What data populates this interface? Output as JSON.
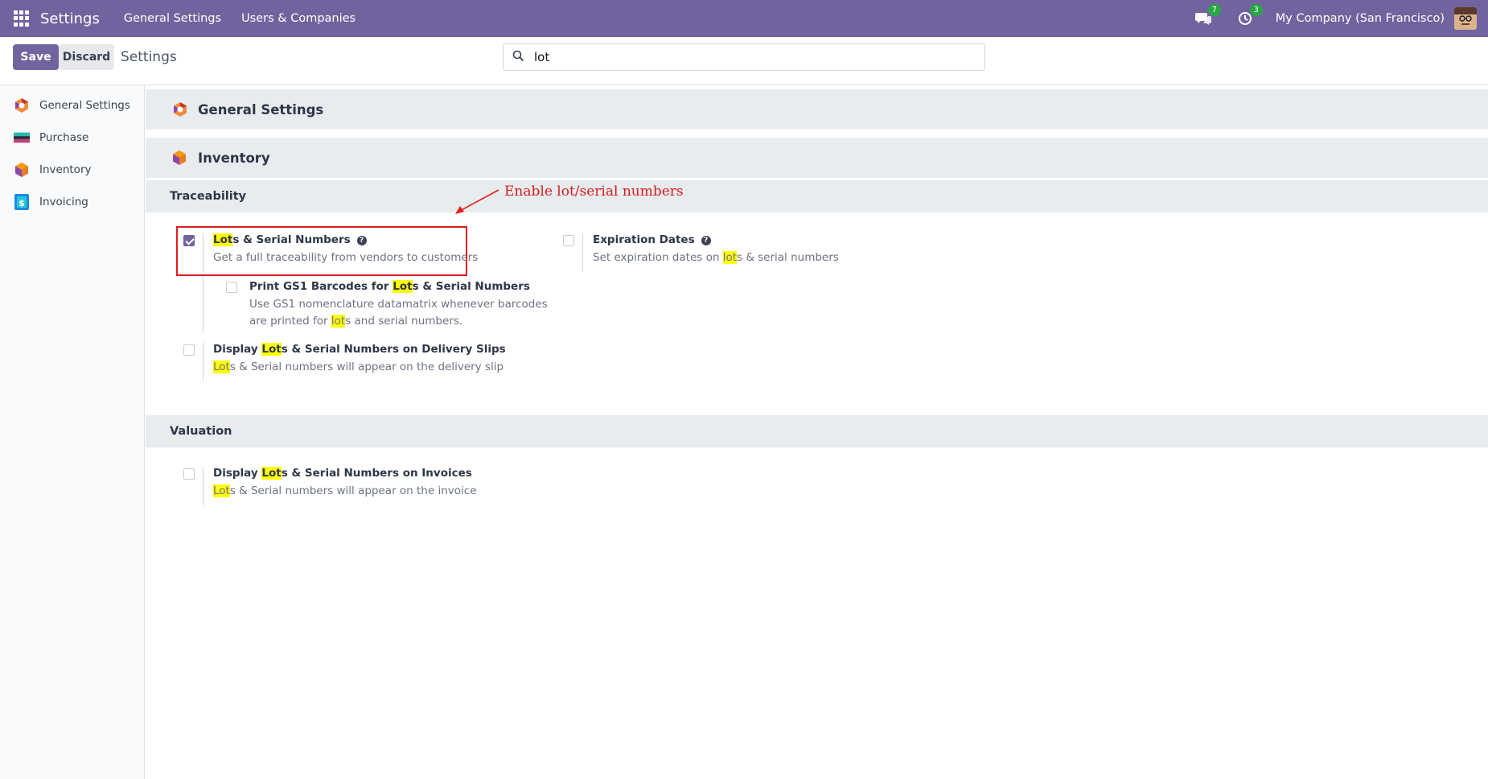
{
  "topbar": {
    "brand": "Settings",
    "menu": [
      "General Settings",
      "Users & Companies"
    ],
    "messages_badge": "7",
    "activities_badge": "3",
    "company": "My Company (San Francisco)",
    "color": "#71639e"
  },
  "control": {
    "save_label": "Save",
    "discard_label": "Discard",
    "title": "Settings",
    "search_value": "lot"
  },
  "sidebar": {
    "items": [
      {
        "label": "General Settings",
        "icon": "general-settings-icon"
      },
      {
        "label": "Purchase",
        "icon": "purchase-icon"
      },
      {
        "label": "Inventory",
        "icon": "inventory-icon"
      },
      {
        "label": "Invoicing",
        "icon": "invoicing-icon"
      }
    ]
  },
  "main": {
    "apps": [
      {
        "title": "General Settings"
      },
      {
        "title": "Inventory"
      }
    ],
    "sections": [
      {
        "title": "Traceability"
      },
      {
        "title": "Valuation"
      }
    ],
    "settings": {
      "lots": {
        "checked": true,
        "title_hl": "Lot",
        "title_rest": "s & Serial Numbers",
        "desc": "Get a full traceability from vendors to customers"
      },
      "expiration": {
        "checked": false,
        "title": "Expiration Dates",
        "desc_pre": "Set expiration dates on ",
        "desc_hl": "lot",
        "desc_post": "s & serial numbers"
      },
      "gs1": {
        "checked": false,
        "title_pre": "Print GS1 Barcodes for ",
        "title_hl": "Lot",
        "title_post": "s & Serial Numbers",
        "desc_line1": "Use GS1 nomenclature datamatrix whenever barcodes",
        "desc_line2_pre": "are printed for ",
        "desc_line2_hl": "lot",
        "desc_line2_post": "s and serial numbers."
      },
      "delivery": {
        "checked": false,
        "title_pre": "Display ",
        "title_hl": "Lot",
        "title_post": "s & Serial Numbers on Delivery Slips",
        "desc_hl": "Lot",
        "desc_post": "s & Serial numbers will appear on the delivery slip"
      },
      "invoices": {
        "checked": false,
        "title_pre": "Display ",
        "title_hl": "Lot",
        "title_post": "s & Serial Numbers on Invoices",
        "desc_hl": "Lot",
        "desc_post": "s & Serial numbers will appear on the invoice"
      }
    }
  },
  "annotation": {
    "text": "Enable lot/serial numbers",
    "color": "#e11d1d"
  }
}
